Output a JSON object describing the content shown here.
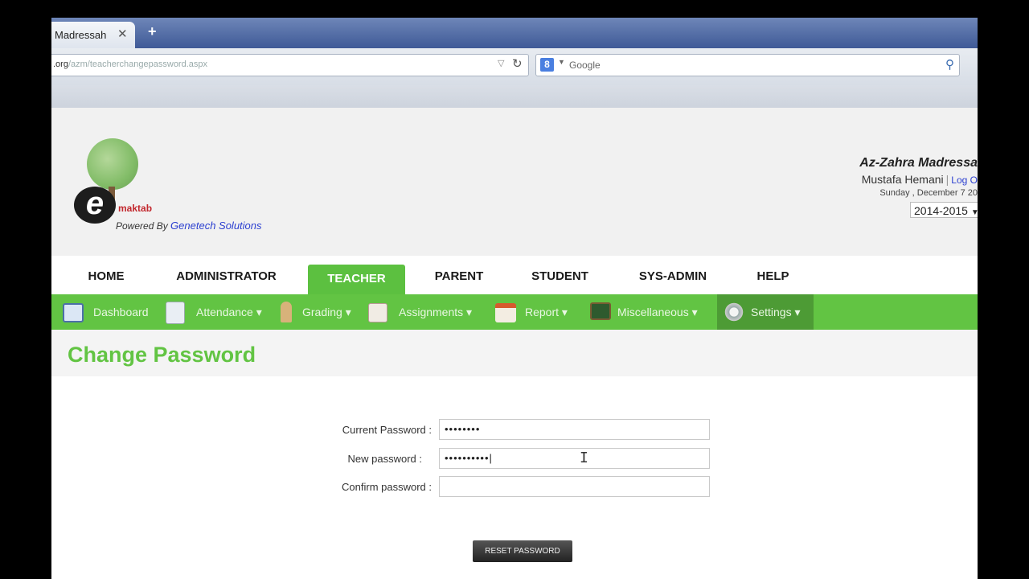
{
  "browser": {
    "tab_title": "Madressah",
    "tab_close": "✕",
    "new_tab": "+",
    "url_domain": ".org",
    "url_path": "/azm/teacherchangepassword.aspx",
    "search_engine_icon": "8",
    "search_placeholder": "Google"
  },
  "header": {
    "logo_text": "maktab",
    "powered_by": "Powered By",
    "company": "Genetech Solutions",
    "madrasa_name": "Az-Zahra Madressa",
    "user_name": "Mustafa Hemani",
    "separator": "|",
    "logout": "Log O",
    "date": "Sunday , December 7 20",
    "academic_year": "2014-2015"
  },
  "main_nav": [
    {
      "label": "HOME"
    },
    {
      "label": "ADMINISTRATOR"
    },
    {
      "label": "TEACHER"
    },
    {
      "label": "PARENT"
    },
    {
      "label": "STUDENT"
    },
    {
      "label": "SYS-ADMIN"
    },
    {
      "label": "HELP"
    }
  ],
  "sub_nav": [
    {
      "label": "Dashboard",
      "icon": "dashboard-icon"
    },
    {
      "label": "Attendance ▾",
      "icon": "attendance-icon"
    },
    {
      "label": "Grading ▾",
      "icon": "grading-icon"
    },
    {
      "label": "Assignments ▾",
      "icon": "assignments-icon"
    },
    {
      "label": "Report ▾",
      "icon": "report-icon"
    },
    {
      "label": "Miscellaneous ▾",
      "icon": "miscellaneous-icon"
    },
    {
      "label": "Settings ▾",
      "icon": "settings-icon"
    }
  ],
  "page": {
    "title": "Change Password",
    "form": {
      "current_label": "Current Password :",
      "current_value": "••••••••",
      "new_label": "New password :",
      "new_value": "••••••••••|",
      "confirm_label": "Confirm password :",
      "confirm_value": ""
    },
    "reset_button": "RESET PASSWORD"
  },
  "colors": {
    "accent_green": "#62c443",
    "link_blue": "#2b3fd0"
  }
}
